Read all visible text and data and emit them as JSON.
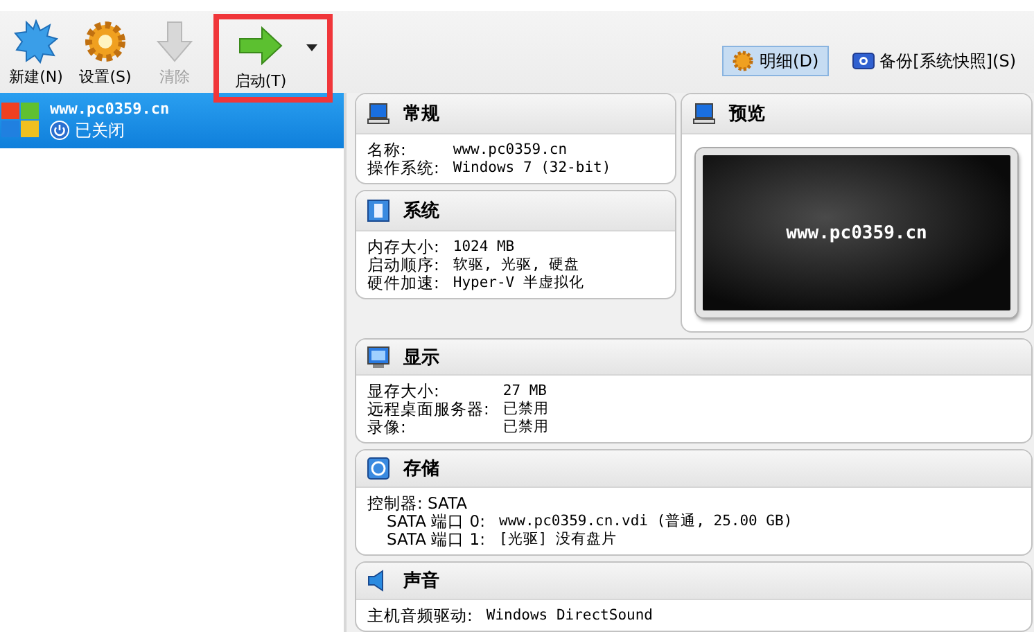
{
  "toolbar": {
    "buttons": [
      {
        "label": "新建(N)",
        "kind": "new",
        "disabled": false
      },
      {
        "label": "设置(S)",
        "kind": "settings",
        "disabled": false
      },
      {
        "label": "清除",
        "kind": "discard",
        "disabled": true
      },
      {
        "label": "启动(T)",
        "kind": "start",
        "disabled": false,
        "highlighted": true
      }
    ],
    "views": [
      {
        "label": "明细(D)",
        "kind": "details",
        "selected": true
      },
      {
        "label": "备份[系统快照](S)",
        "kind": "snapshots",
        "selected": false
      }
    ]
  },
  "vm_list": [
    {
      "name": "www.pc0359.cn",
      "state": "已关闭",
      "selected": true
    }
  ],
  "sections": [
    {
      "title": "常规",
      "rows": [
        {
          "kind": "pair",
          "label": "名称:",
          "value": "www.pc0359.cn"
        },
        {
          "kind": "pair",
          "label": "操作系统:",
          "value": "Windows 7 (32-bit)"
        }
      ]
    },
    {
      "title": "预览",
      "preview": "www.pc0359.cn"
    },
    {
      "title": "系统",
      "rows": [
        {
          "kind": "pair",
          "label": "内存大小:",
          "value": "1024 MB"
        },
        {
          "kind": "pair",
          "label": "启动顺序:",
          "value": "软驱, 光驱, 硬盘"
        },
        {
          "kind": "pair",
          "label": "硬件加速:",
          "value": "Hyper-V 半虚拟化"
        }
      ]
    },
    {
      "title": "显示",
      "rows": [
        {
          "kind": "pair",
          "label": "显存大小:",
          "value": "27 MB"
        },
        {
          "kind": "pair",
          "label": "远程桌面服务器:",
          "value": "已禁用"
        },
        {
          "kind": "pair",
          "label": "录像:",
          "value": "已禁用"
        }
      ]
    },
    {
      "title": "存储",
      "rows": [
        {
          "kind": "line",
          "label": "控制器: SATA"
        },
        {
          "kind": "port",
          "label": "SATA 端口 0:",
          "value": "www.pc0359.cn.vdi (普通, 25.00 GB)"
        },
        {
          "kind": "port",
          "label": "SATA 端口 1:",
          "value": "[光驱] 没有盘片"
        }
      ]
    },
    {
      "title": "声音",
      "rows": [
        {
          "kind": "pair",
          "label": "主机音频驱动:",
          "value": "Windows DirectSound"
        }
      ]
    }
  ]
}
